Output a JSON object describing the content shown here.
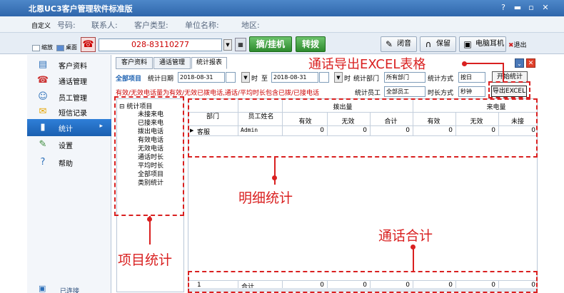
{
  "window": {
    "title": "北恩UC3客户管理软件标准版"
  },
  "info_bar": {
    "custom_label": "自定义",
    "phone_label": "号码:",
    "contact_label": "联系人:",
    "customer_type_label": "客户类型:",
    "company_label": "单位名称:",
    "region_label": "地区:"
  },
  "toolbar": {
    "shrink_label": "缩放",
    "desktop_label": "桌面",
    "phone_number": "028-83110277",
    "dial_label": "摘/挂机",
    "transfer_label": "转拨",
    "mute_label": "闭音",
    "hold_label": "保留",
    "pc_headset_label": "电脑耳机",
    "exit_label": "退出"
  },
  "sidebar": {
    "items": [
      {
        "label": "客户资料",
        "icon": "contacts-icon"
      },
      {
        "label": "通话管理",
        "icon": "phone-icon"
      },
      {
        "label": "员工管理",
        "icon": "staff-icon"
      },
      {
        "label": "短信记录",
        "icon": "envelope-icon"
      },
      {
        "label": "统计",
        "icon": "bar-chart-icon"
      },
      {
        "label": "设置",
        "icon": "settings-icon"
      },
      {
        "label": "帮助",
        "icon": "help-icon"
      }
    ],
    "status": "已连接"
  },
  "tabs": [
    "客户资料",
    "通话管理",
    "统计报表"
  ],
  "filters": {
    "all_items": "全部项目",
    "stat_date_label": "统计日期",
    "date_from": "2018-08-31",
    "hour_label": "时",
    "to_label": "至",
    "date_to": "2018-08-31",
    "hour_label2": "时",
    "dept_label": "统计部门",
    "dept_value": "所有部门",
    "method_label": "统计方式",
    "method_value": "按日",
    "start_button": "开始统计",
    "note": "有效/无效电话量为有效/无效已拨电话,通话/平均时长包含已拨/已接电话",
    "staff_label": "统计员工",
    "staff_value": "全部员工",
    "duration_label": "时长方式",
    "duration_value": "秒钟",
    "export_button": "导出EXCEL"
  },
  "tree": {
    "root": "统计项目",
    "items": [
      "未接来电",
      "已接来电",
      "拨出电话",
      "有效电话",
      "无效电话",
      "通话时长",
      "平均时长",
      "全部项目",
      "类别统计"
    ]
  },
  "grid": {
    "dept_header": "部门",
    "staff_header": "员工姓名",
    "outgoing_group": "拨出量",
    "incoming_group": "来电量",
    "sub_headers": [
      "有效",
      "无效",
      "合计",
      "有效",
      "无效",
      "未接"
    ],
    "rows": [
      {
        "marker": "▶",
        "dept": "客服",
        "staff": "Admin",
        "values": [
          "0",
          "0",
          "0",
          "0",
          "0",
          "0"
        ]
      }
    ],
    "total_row": {
      "index": "1",
      "label": "合计",
      "values": [
        "0",
        "0",
        "0",
        "0",
        "0",
        "0"
      ]
    }
  },
  "annotations": {
    "export_excel": "通话导出EXCEL表格",
    "detail_stats": "明细统计",
    "call_total": "通话合计",
    "item_stats": "项目统计"
  },
  "colors": {
    "annotation_red": "#d92020",
    "title_blue": "#2f66ab",
    "phone_red": "#cc0000"
  }
}
